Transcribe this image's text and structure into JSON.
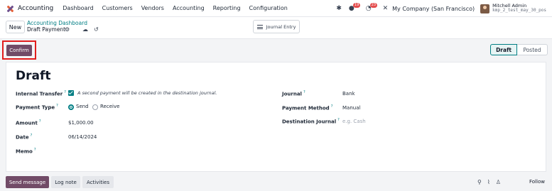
{
  "topnav": {
    "app_name": "Accounting",
    "menu": [
      "Dashboard",
      "Customers",
      "Vendors",
      "Accounting",
      "Reporting",
      "Configuration"
    ],
    "chat_count": "19",
    "activity_count": "23",
    "company": "My Company (San Francisco)",
    "user_name": "Mitchell Admin",
    "user_db": "kmp_2_test_may_30_pos"
  },
  "control_panel": {
    "new_label": "New",
    "breadcrumb_parent": "Accounting Dashboard",
    "breadcrumb_current": "Draft Payment",
    "journal_entry_label": "Journal Entry"
  },
  "actions": {
    "confirm_label": "Confirm",
    "status_steps": [
      "Draft",
      "Posted"
    ],
    "status_active": "Draft"
  },
  "form": {
    "title": "Draft",
    "internal_transfer_label": "Internal Transfer",
    "internal_transfer_note": "A second payment will be created in the destination journal.",
    "payment_type_label": "Payment Type",
    "payment_type_send": "Send",
    "payment_type_receive": "Receive",
    "amount_label": "Amount",
    "amount_value": "$1,000.00",
    "date_label": "Date",
    "date_value": "06/14/2024",
    "memo_label": "Memo",
    "journal_label": "Journal",
    "journal_value": "Bank",
    "payment_method_label": "Payment Method",
    "payment_method_value": "Manual",
    "destination_journal_label": "Destination Journal",
    "destination_journal_placeholder": "e.g. Cash",
    "help_mark": "?"
  },
  "chatter": {
    "send_message": "Send message",
    "log_note": "Log note",
    "activities": "Activities",
    "follow": "Follow"
  },
  "colors": {
    "brand": "#714b67",
    "accent": "#017e84",
    "highlight": "#e11d1d"
  }
}
